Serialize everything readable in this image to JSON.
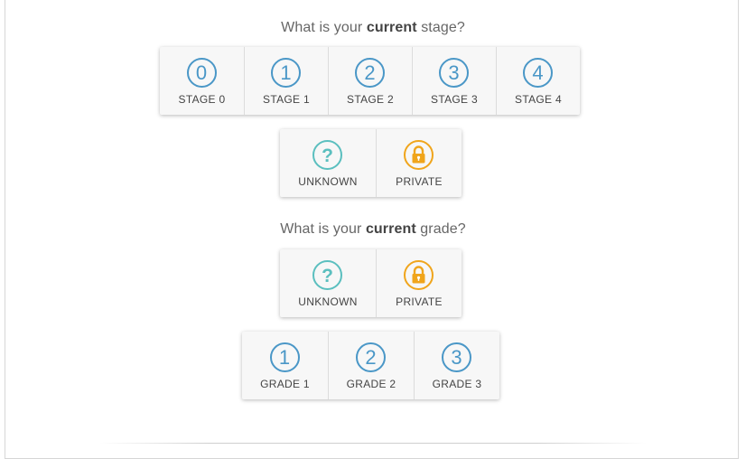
{
  "stage_question": {
    "prefix": "What is your ",
    "emphasis": "current",
    "suffix": " stage?"
  },
  "stage_options": [
    {
      "numeral": "0",
      "label": "STAGE 0"
    },
    {
      "numeral": "1",
      "label": "STAGE 1"
    },
    {
      "numeral": "2",
      "label": "STAGE 2"
    },
    {
      "numeral": "3",
      "label": "STAGE 3"
    },
    {
      "numeral": "4",
      "label": "STAGE 4"
    }
  ],
  "stage_special_options": [
    {
      "label": "UNKNOWN",
      "icon": "question-mark-icon",
      "glyph": "?"
    },
    {
      "label": "PRIVATE",
      "icon": "lock-icon"
    }
  ],
  "grade_question": {
    "prefix": "What is your ",
    "emphasis": "current",
    "suffix": " grade?"
  },
  "grade_special_options": [
    {
      "label": "UNKNOWN",
      "icon": "question-mark-icon",
      "glyph": "?"
    },
    {
      "label": "PRIVATE",
      "icon": "lock-icon"
    }
  ],
  "grade_options": [
    {
      "numeral": "1",
      "label": "GRADE 1"
    },
    {
      "numeral": "2",
      "label": "GRADE 2"
    },
    {
      "numeral": "3",
      "label": "GRADE 3"
    }
  ],
  "colors": {
    "number": "#4a97c7",
    "unknown": "#5bbfbf",
    "private": "#f0a51c"
  }
}
